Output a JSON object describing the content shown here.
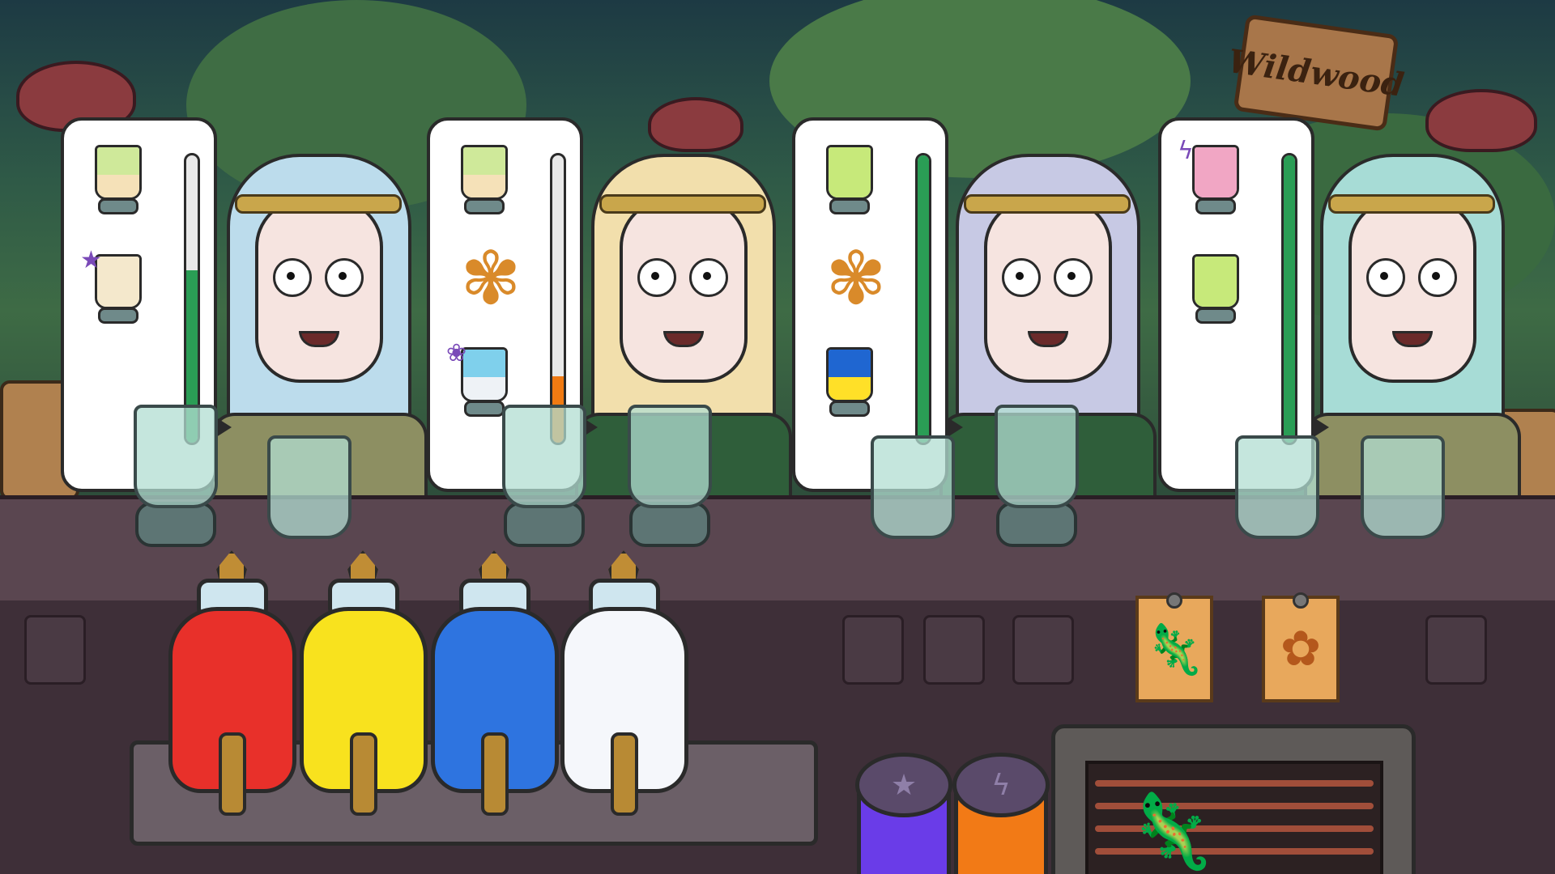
{
  "location_sign": "Wildwood",
  "customers": [
    {
      "name_key": "elf-1",
      "hair_color": "#bcdcec",
      "robe_color": "#8d8f62",
      "patience_fraction": 0.6,
      "order": [
        {
          "item": "lime-cream-drink",
          "top": "#cfe99a",
          "bottom": "#f5e1b8"
        },
        {
          "item": "cream-drink-with-star-garnish",
          "top": "#f4e8cc",
          "bottom": "#f4e8cc",
          "garnish": "star-fruit-icon"
        }
      ]
    },
    {
      "name_key": "elf-2",
      "hair_color": "#f2dfac",
      "robe_color": "#2f5e3a",
      "patience_fraction": 0.23,
      "order": [
        {
          "item": "lime-cream-drink",
          "top": "#cfe99a",
          "bottom": "#f5e1b8"
        },
        {
          "item": "mandrake-root",
          "icon": "mandrake-root-icon"
        },
        {
          "item": "blue-milk-drink-with-butterfly",
          "top": "#7fd0ec",
          "bottom": "#eef2f6",
          "garnish": "butterfly-icon"
        }
      ]
    },
    {
      "name_key": "elf-3",
      "hair_color": "#c7c9e4",
      "robe_color": "#2f5e3a",
      "patience_fraction": 1.0,
      "order": [
        {
          "item": "lime-drink",
          "top": "#c7e97a",
          "bottom": "#c7e97a"
        },
        {
          "item": "mandrake-root",
          "icon": "mandrake-root-icon"
        },
        {
          "item": "blue-yellow-drink",
          "top": "#1f66d1",
          "bottom": "#ffe028"
        }
      ]
    },
    {
      "name_key": "elf-4",
      "hair_color": "#a7dcd6",
      "robe_color": "#8d8f62",
      "patience_fraction": 1.0,
      "order": [
        {
          "item": "pink-drink-with-lightning",
          "top": "#f1a6c4",
          "bottom": "#f1a6c4",
          "garnish": "lightning-icon"
        },
        {
          "item": "lime-drink",
          "top": "#c7e97a",
          "bottom": "#c7e97a"
        }
      ]
    }
  ],
  "dispensers": [
    {
      "name_key": "red",
      "color": "#e8302a"
    },
    {
      "name_key": "yellow",
      "color": "#f8e21e"
    },
    {
      "name_key": "blue",
      "color": "#2e74e0"
    },
    {
      "name_key": "milk",
      "color": "#f5f7fb"
    }
  ],
  "jars": [
    {
      "name_key": "purple-star",
      "color": "#6a3ce8",
      "icon": "star-icon",
      "glyph": "★"
    },
    {
      "name_key": "orange-lightning",
      "color": "#f27a16",
      "icon": "lightning-icon",
      "glyph": "ϟ"
    }
  ],
  "posters": [
    {
      "name_key": "salamander",
      "icon": "salamander-icon",
      "glyph": "🦎"
    },
    {
      "name_key": "mandrake",
      "icon": "mandrake-icon",
      "glyph": "✿"
    }
  ],
  "grill_item": {
    "icon": "roasting-salamander-icon",
    "glyph": "🦎"
  },
  "colors": {
    "bubble_border": "#2a2a2a",
    "patience_green": "#2a9d55",
    "patience_orange": "#f07a12"
  }
}
